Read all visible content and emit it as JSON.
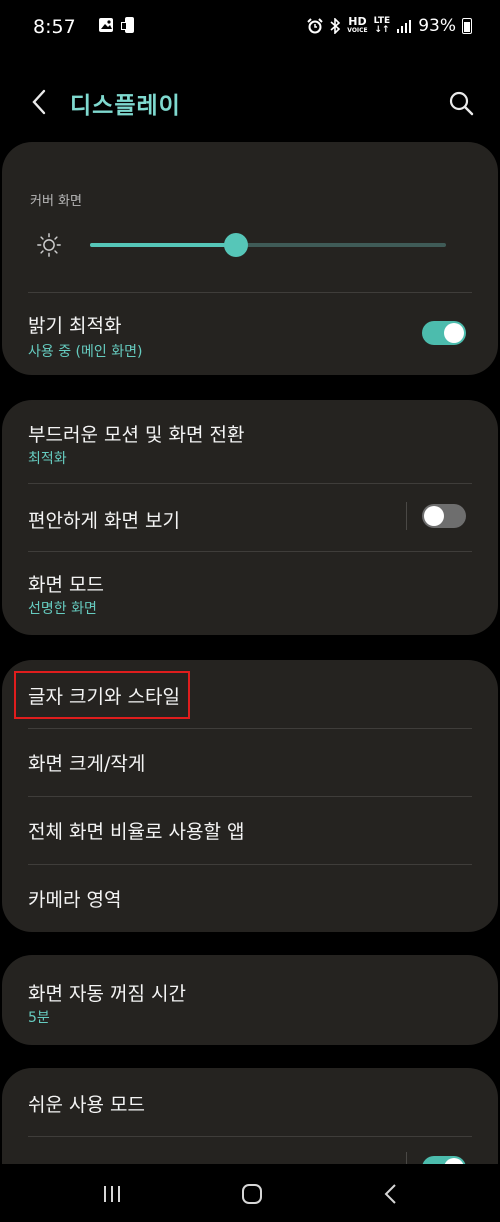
{
  "status": {
    "time": "8:57",
    "hd": "HD",
    "voice": "VOICE",
    "lte": "LTE",
    "battery": "93%"
  },
  "header": {
    "title": "디스플레이"
  },
  "brightness_card": {
    "label": "커버 화면",
    "slider_level_fraction": 0.41,
    "adaptive_title": "밝기 최적화",
    "adaptive_sub": "사용 중 (메인 화면)",
    "adaptive_on": true
  },
  "motion_card": {
    "smooth_title": "부드러운 모션 및 화면 전환",
    "smooth_sub": "최적화",
    "eye_comfort_title": "편안하게 화면 보기",
    "eye_comfort_on": false,
    "screen_mode_title": "화면 모드",
    "screen_mode_sub": "선명한 화면"
  },
  "font_card": {
    "font_title": "글자 크기와 스타일",
    "zoom_title": "화면 크게/작게",
    "fullscreen_title": "전체 화면 비율로 사용할 앱",
    "cutout_title": "카메라 영역"
  },
  "timeout_card": {
    "title": "화면 자동 꺼짐 시간",
    "sub": "5분"
  },
  "easy_card": {
    "title": "쉬운 사용 모드"
  },
  "colors": {
    "accent": "#56c6b8",
    "card_bg": "#252320",
    "highlight": "#e01d1d"
  }
}
